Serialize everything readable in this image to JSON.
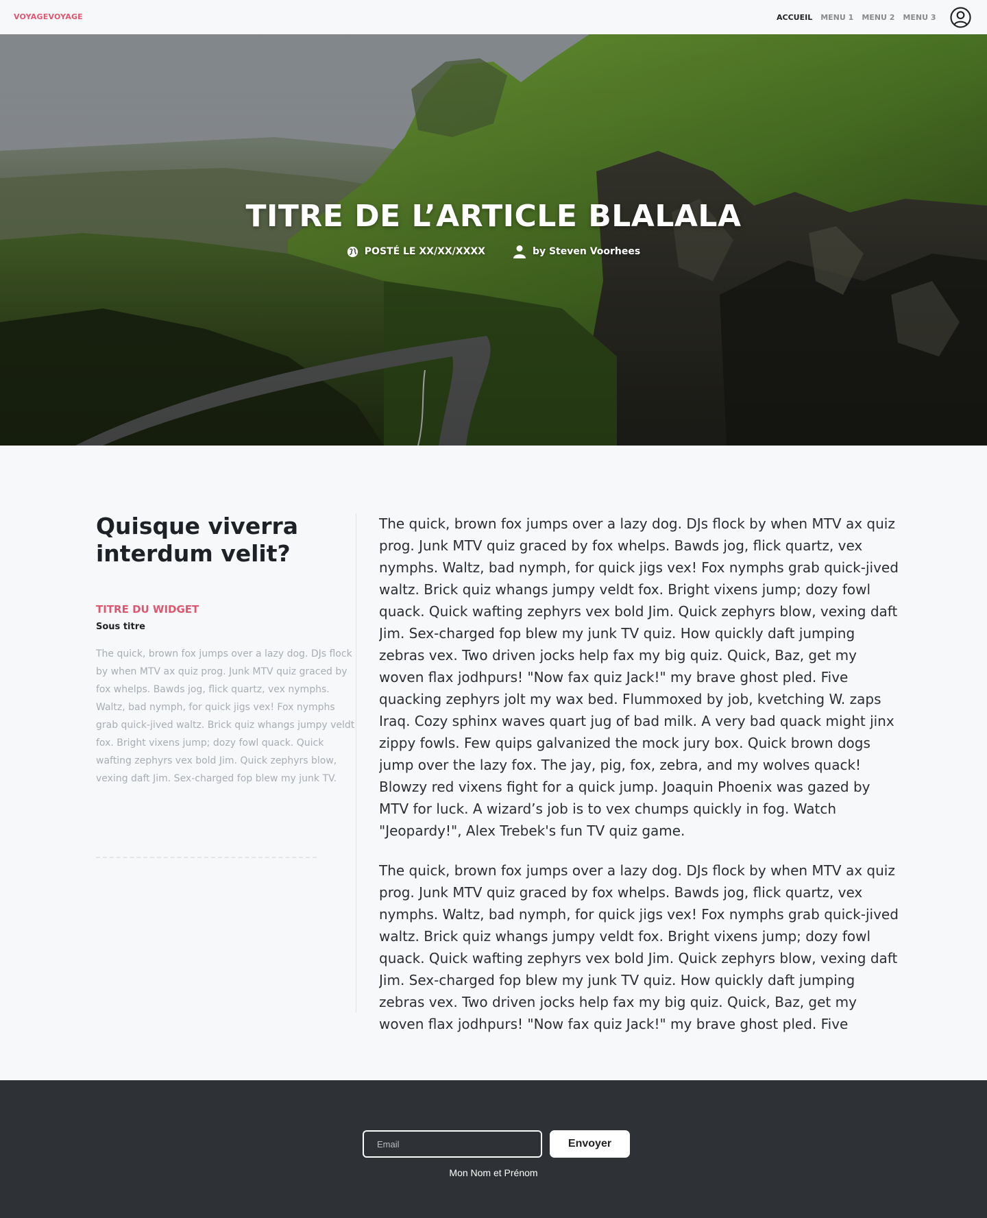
{
  "header": {
    "brand": "VOYAGEVOYAGE",
    "nav": [
      "ACCUEIL",
      "MENU 1",
      "MENU 2",
      "MENU 3"
    ],
    "active_nav": "ACCUEIL",
    "user_icon": "user-circle-icon"
  },
  "hero": {
    "title": "TITRE DE L’ARTICLE BLALALA",
    "posted": "POSTÉ LE XX/XX/XXXX",
    "posted_icon": "globe-icon",
    "author": "by Steven Voorhees",
    "author_icon": "user-icon"
  },
  "sidebar": {
    "title": "Quisque viverra interdum velit?",
    "widget_title": "TITRE DU WIDGET",
    "widget_subtitle": "Sous titre",
    "widget_text": "The quick, brown fox jumps over a lazy dog. DJs flock by when MTV ax quiz prog. Junk MTV quiz graced by fox whelps. Bawds jog, flick quartz, vex nymphs. Waltz, bad nymph, for quick jigs vex! Fox nymphs grab quick-jived waltz. Brick quiz whangs jumpy veldt fox. Bright vixens jump; dozy fowl quack. Quick wafting zephyrs vex bold Jim. Quick zephyrs blow, vexing daft Jim. Sex-charged fop blew my junk TV."
  },
  "article": {
    "paragraphs": [
      "The quick, brown fox jumps over a lazy dog. DJs flock by when MTV ax quiz prog. Junk MTV quiz graced by fox whelps. Bawds jog, flick quartz, vex nymphs. Waltz, bad nymph, for quick jigs vex! Fox nymphs grab quick-jived waltz. Brick quiz whangs jumpy veldt fox. Bright vixens jump; dozy fowl quack. Quick wafting zephyrs vex bold Jim. Quick zephyrs blow, vexing daft Jim. Sex-charged fop blew my junk TV quiz. How quickly daft jumping zebras vex. Two driven jocks help fax my big quiz. Quick, Baz, get my woven flax jodhpurs! \"Now fax quiz Jack!\" my brave ghost pled. Five quacking zephyrs jolt my wax bed. Flummoxed by job, kvetching W. zaps Iraq. Cozy sphinx waves quart jug of bad milk. A very bad quack might jinx zippy fowls. Few quips galvanized the mock jury box. Quick brown dogs jump over the lazy fox. The jay, pig, fox, zebra, and my wolves quack! Blowzy red vixens fight for a quick jump. Joaquin Phoenix was gazed by MTV for luck. A wizard’s job is to vex chumps quickly in fog. Watch \"Jeopardy!\", Alex Trebek's fun TV quiz game.",
      "The quick, brown fox jumps over a lazy dog. DJs flock by when MTV ax quiz prog. Junk MTV quiz graced by fox whelps. Bawds jog, flick quartz, vex nymphs. Waltz, bad nymph, for quick jigs vex! Fox nymphs grab quick-jived waltz. Brick quiz whangs jumpy veldt fox. Bright vixens jump; dozy fowl quack. Quick wafting zephyrs vex bold Jim. Quick zephyrs blow, vexing daft Jim. Sex-charged fop blew my junk TV quiz. How quickly daft jumping zebras vex. Two driven jocks help fax my big quiz. Quick, Baz, get my woven flax jodhpurs! \"Now fax quiz Jack!\" my brave ghost pled. Five quacking zephyrs jolt my wax bed. Flummoxed by job, kvetching W. zaps Iraq. Cozy sphinx waves quart jug of bad milk. A very bad quack"
    ]
  },
  "footer": {
    "email_placeholder": "Email",
    "send_label": "Envoyer",
    "name": "Mon Nom et Prénom"
  },
  "colors": {
    "accent": "#e0566f",
    "footer_bg": "#2e3136",
    "page_bg": "#f7f8fa"
  }
}
